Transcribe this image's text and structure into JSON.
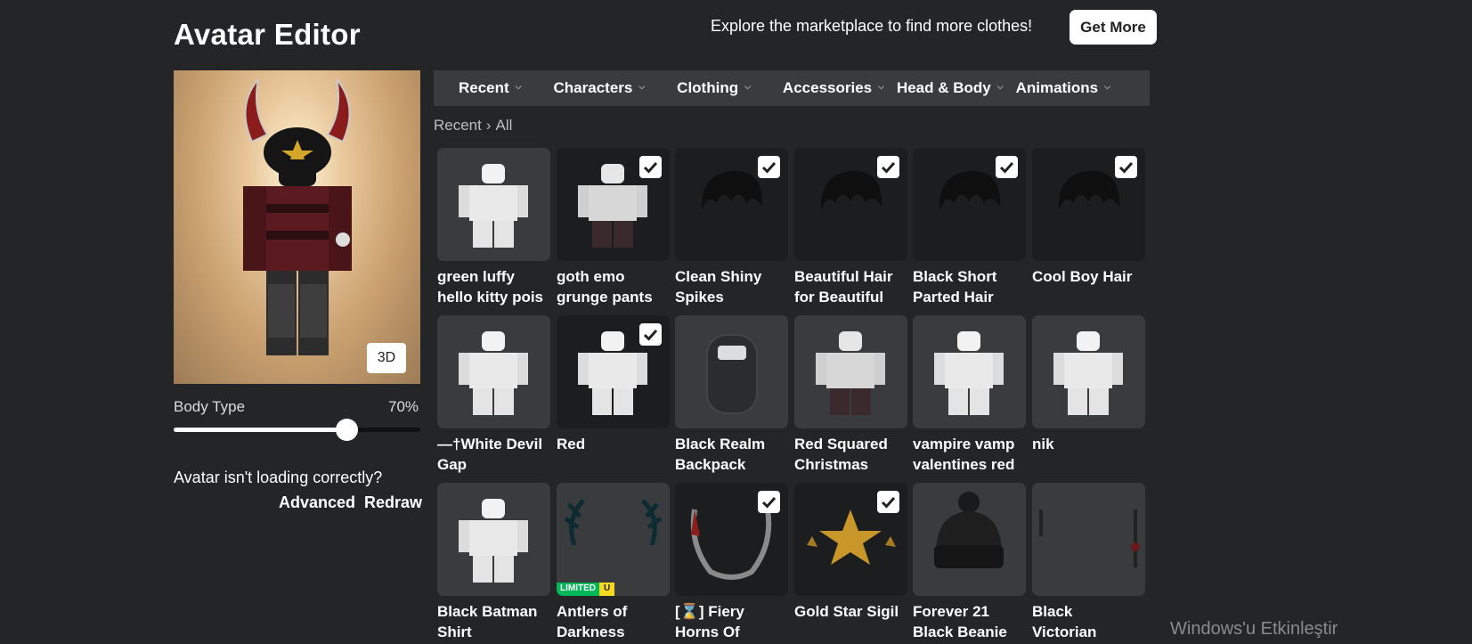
{
  "header": {
    "title": "Avatar Editor",
    "promo_text": "Explore the marketplace to find more clothes!",
    "get_more_label": "Get More"
  },
  "avatar": {
    "view_toggle_label": "3D",
    "body_type_label": "Body Type",
    "body_type_value": "70%",
    "body_type_fraction": 0.7,
    "loading_question": "Avatar isn't loading correctly?",
    "advanced_label": "Advanced",
    "redraw_label": "Redraw"
  },
  "tabs": [
    {
      "label": "Recent"
    },
    {
      "label": "Characters"
    },
    {
      "label": "Clothing"
    },
    {
      "label": "Accessories"
    },
    {
      "label": "Head & Body"
    },
    {
      "label": "Animations"
    }
  ],
  "breadcrumb": {
    "parent": "Recent",
    "separator": "›",
    "current": "All"
  },
  "items": [
    {
      "line1": "green luffy",
      "line2": "hello kitty pois",
      "equipped": false,
      "icon": "shirt-avatar-icon"
    },
    {
      "line1": "goth emo",
      "line2": "grunge pants",
      "equipped": true,
      "icon": "pants-avatar-icon"
    },
    {
      "line1": "Clean Shiny",
      "line2": "Spikes",
      "equipped": true,
      "icon": "hair-icon"
    },
    {
      "line1": "Beautiful Hair",
      "line2": "for Beautiful",
      "equipped": true,
      "icon": "hair-icon"
    },
    {
      "line1": "Black Short",
      "line2": "Parted Hair",
      "equipped": true,
      "icon": "hair-icon"
    },
    {
      "line1": "Cool Boy Hair",
      "line2": "",
      "equipped": true,
      "icon": "hair-icon"
    },
    {
      "line1": "—†White Devil",
      "line2": "Gap",
      "equipped": false,
      "icon": "shirt-avatar-icon"
    },
    {
      "line1": "Red",
      "line2": "",
      "equipped": true,
      "icon": "shirt-avatar-icon"
    },
    {
      "line1": "Black Realm",
      "line2": "Backpack",
      "equipped": false,
      "icon": "backpack-icon"
    },
    {
      "line1": "Red Squared",
      "line2": "Christmas",
      "equipped": false,
      "icon": "pants-avatar-icon"
    },
    {
      "line1": "vampire vamp",
      "line2": "valentines red",
      "equipped": false,
      "icon": "shirt-avatar-icon"
    },
    {
      "line1": "nik",
      "line2": "",
      "equipped": false,
      "icon": "shirt-avatar-icon"
    },
    {
      "line1": "Black Batman",
      "line2": "Shirt",
      "equipped": false,
      "icon": "shirt-avatar-icon"
    },
    {
      "line1": "Antlers of",
      "line2": "Darkness",
      "equipped": false,
      "icon": "antlers-icon",
      "limited": true
    },
    {
      "line1": "[⌛] Fiery",
      "line2": "Horns Of",
      "equipped": true,
      "icon": "horns-icon"
    },
    {
      "line1": "Gold Star Sigil",
      "line2": "",
      "equipped": true,
      "icon": "star-icon"
    },
    {
      "line1": "Forever 21",
      "line2": "Black Beanie",
      "equipped": false,
      "icon": "beanie-icon"
    },
    {
      "line1": "Black",
      "line2": "Victorian",
      "equipped": false,
      "icon": "earring-icon"
    }
  ],
  "limited_badge": {
    "label": "LIMITED",
    "u": "U"
  },
  "os_watermark": "Windows'u Etkinleştir"
}
